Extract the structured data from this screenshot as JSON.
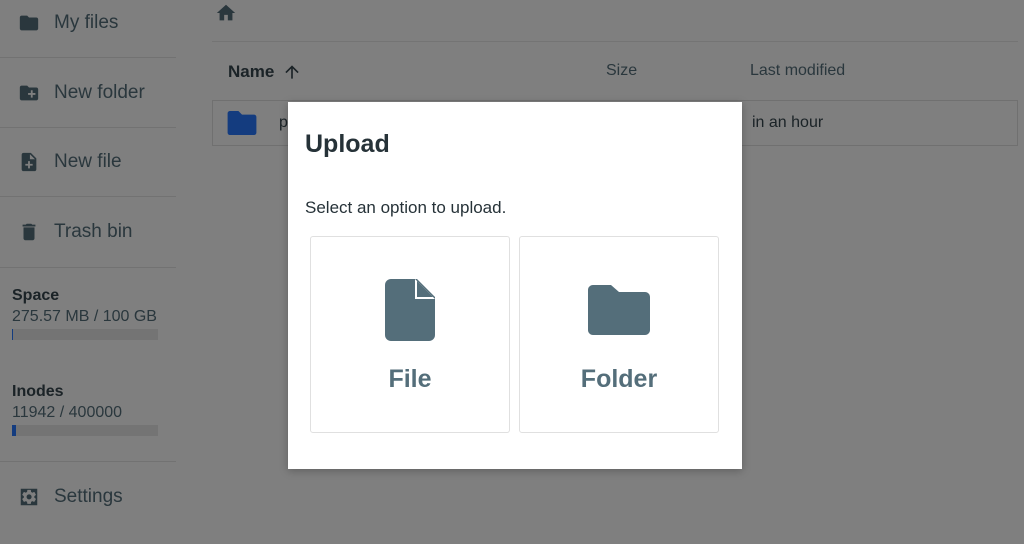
{
  "sidebar": {
    "items": [
      {
        "label": "My files",
        "icon": "folder-icon"
      },
      {
        "label": "New folder",
        "icon": "folder-plus-icon"
      },
      {
        "label": "New file",
        "icon": "file-plus-icon"
      },
      {
        "label": "Trash bin",
        "icon": "trash-icon"
      }
    ],
    "space": {
      "label": "Space",
      "value": "275.57 MB / 100 GB",
      "used_fraction": 0.0027
    },
    "inodes": {
      "label": "Inodes",
      "value": "11942 / 400000",
      "used_fraction": 0.03
    },
    "settings": {
      "label": "Settings",
      "icon": "gear-icon"
    }
  },
  "main": {
    "breadcrumb_icon": "home-icon",
    "columns": {
      "name": "Name",
      "size": "Size",
      "modified": "Last modified"
    },
    "rows": [
      {
        "name": "p",
        "size": "",
        "modified": "in an hour",
        "icon": "folder-icon"
      }
    ]
  },
  "modal": {
    "title": "Upload",
    "text": "Select an option to upload.",
    "options": [
      {
        "label": "File",
        "icon": "file-icon"
      },
      {
        "label": "Folder",
        "icon": "folder-icon"
      }
    ]
  },
  "colors": {
    "icon_gray": "#546e7a",
    "accent_blue": "#2979ff",
    "overlay": "rgba(0,0,0,0.5)"
  }
}
